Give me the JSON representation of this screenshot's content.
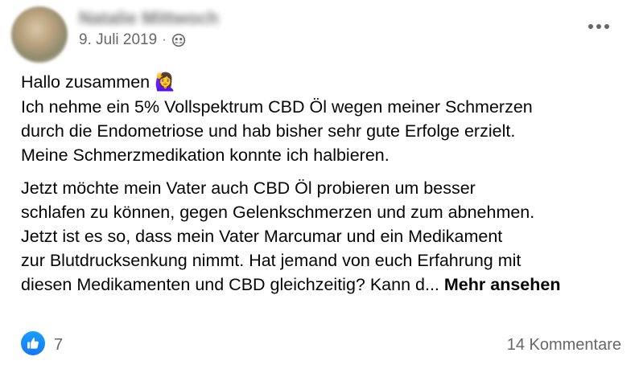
{
  "post": {
    "author_name": "Natalie Mittwoch",
    "date": "9. Juli 2019",
    "separator": "·",
    "audience_icon": "group-icon",
    "more_icon": "more-options-icon",
    "paragraph1": {
      "greeting": "Hallo zusammen",
      "greeting_emoji": "🙋‍♀️",
      "lines": [
        "Ich nehme ein 5% Vollspektrum CBD Öl wegen meiner Schmerzen",
        "durch die Endometriose und hab bisher sehr gute Erfolge erzielt.",
        "Meine Schmerzmedikation konnte ich halbieren."
      ]
    },
    "paragraph2": {
      "lines": [
        "Jetzt möchte mein Vater auch CBD Öl probieren um besser",
        "schlafen zu können, gegen Gelenkschmerzen und zum abnehmen.",
        "Jetzt ist es so, dass mein Vater Marcumar und ein Medikament",
        "zur Blutdrucksenkung nimmt. Hat jemand von euch Erfahrung mit"
      ],
      "last_line": "diesen Medikamenten und CBD gleichzeitig? Kann d...",
      "see_more": "Mehr ansehen"
    },
    "footer": {
      "reaction_icon": "like-icon",
      "reaction_count": "7",
      "comments": "14 Kommentare"
    },
    "colors": {
      "text": "#050505",
      "secondary_text": "#65676b",
      "like_blue": "#1877f2"
    }
  }
}
